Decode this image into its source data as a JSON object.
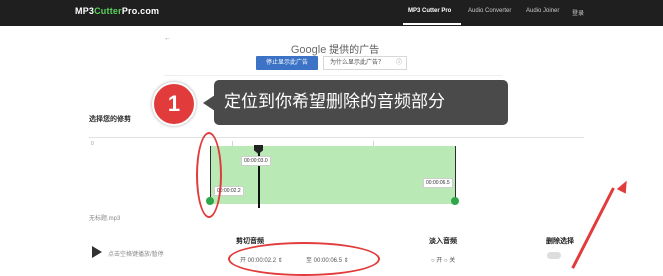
{
  "header": {
    "logo_part1": "MP3",
    "logo_part2": "Cutter",
    "logo_part3": "Pro.com",
    "nav": [
      "MP3 Cutter Pro",
      "Audio Converter",
      "Audio Joiner",
      "登录"
    ]
  },
  "ad": {
    "back": "←",
    "brand": "Google",
    "title_suffix": " 提供的广告",
    "stop_button": "停止显示此广告",
    "why_button": "为什么显示此广告？",
    "info_icon": "ⓘ"
  },
  "tutorial": {
    "step_number": "1",
    "callout_text": "定位到你希望删除的音频部分"
  },
  "editor": {
    "section_label": "选择您的修剪",
    "ticks": [
      "0",
      "|",
      "|"
    ],
    "playhead_time": "00:00:03.0",
    "start_time": "00:00:02.2",
    "end_time": "00:00:06.5",
    "file_name": "无标题.mp3",
    "play_hint": "点击空格键播放/暂停",
    "cut_label": "剪切音频",
    "cut_start": "开 00:00:02.2 ⇕",
    "cut_end": "至 00:00:06.5 ⇕",
    "fade_label": "淡入音频",
    "fade_options": "○ 开   ○ 关",
    "delete_label": "删除选择"
  },
  "colors": {
    "topbar": "#1f1f1f",
    "accent_green": "#5bd25b",
    "waveform": "#b9eab5",
    "annotation_red": "#e23b3b",
    "callout_bg": "#4a4a4a",
    "ad_button": "#3c73c6"
  }
}
